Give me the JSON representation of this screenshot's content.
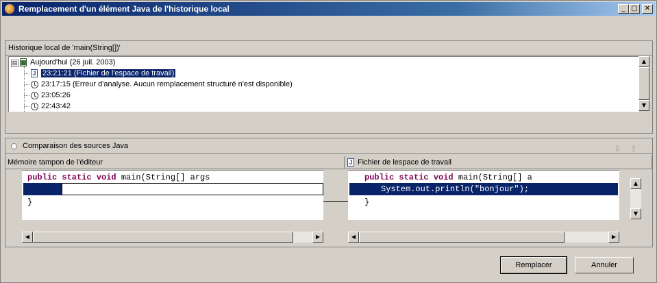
{
  "window": {
    "title": "Remplacement d'un élément Java de l'historique local",
    "minimize": "_",
    "maximize": "□",
    "close": "✕"
  },
  "history": {
    "label": "Historique local de 'main(String[])'",
    "root": {
      "label": "Aujourd'hui (26 juil. 2003)",
      "expander": "⊟"
    },
    "entries": [
      {
        "label": "23:21:21 (Fichier de l'espace de travail)",
        "icon": "java-file-icon",
        "selected": true
      },
      {
        "label": "23:17:15 (Erreur d'analyse. Aucun remplacement structuré n'est disponible)",
        "icon": "clock-icon"
      },
      {
        "label": "23:05:26",
        "icon": "clock-icon"
      },
      {
        "label": "22:43:42",
        "icon": "clock-icon"
      }
    ]
  },
  "compare": {
    "title": "Comparaison des sources Java",
    "down_icon": "⇩",
    "up_icon": "⇧",
    "left": {
      "header": "Mémoire tampon de l'éditeur",
      "line1_kw": "public static void",
      "line1_rest": " main(String[] args",
      "line3": "}"
    },
    "right": {
      "header": "Fichier de lespace de travail",
      "line1_kw": "public static void",
      "line1_rest": " main(String[] a",
      "line2": "System.out.println(\"bonjour\");",
      "line3": "}"
    }
  },
  "buttons": {
    "replace": "Remplacer",
    "cancel": "Annuler"
  },
  "icons": {
    "java": "J"
  },
  "colors": {
    "selection": "#0a246a",
    "keyword": "#7f0055",
    "titlebar": "#0a246a"
  }
}
